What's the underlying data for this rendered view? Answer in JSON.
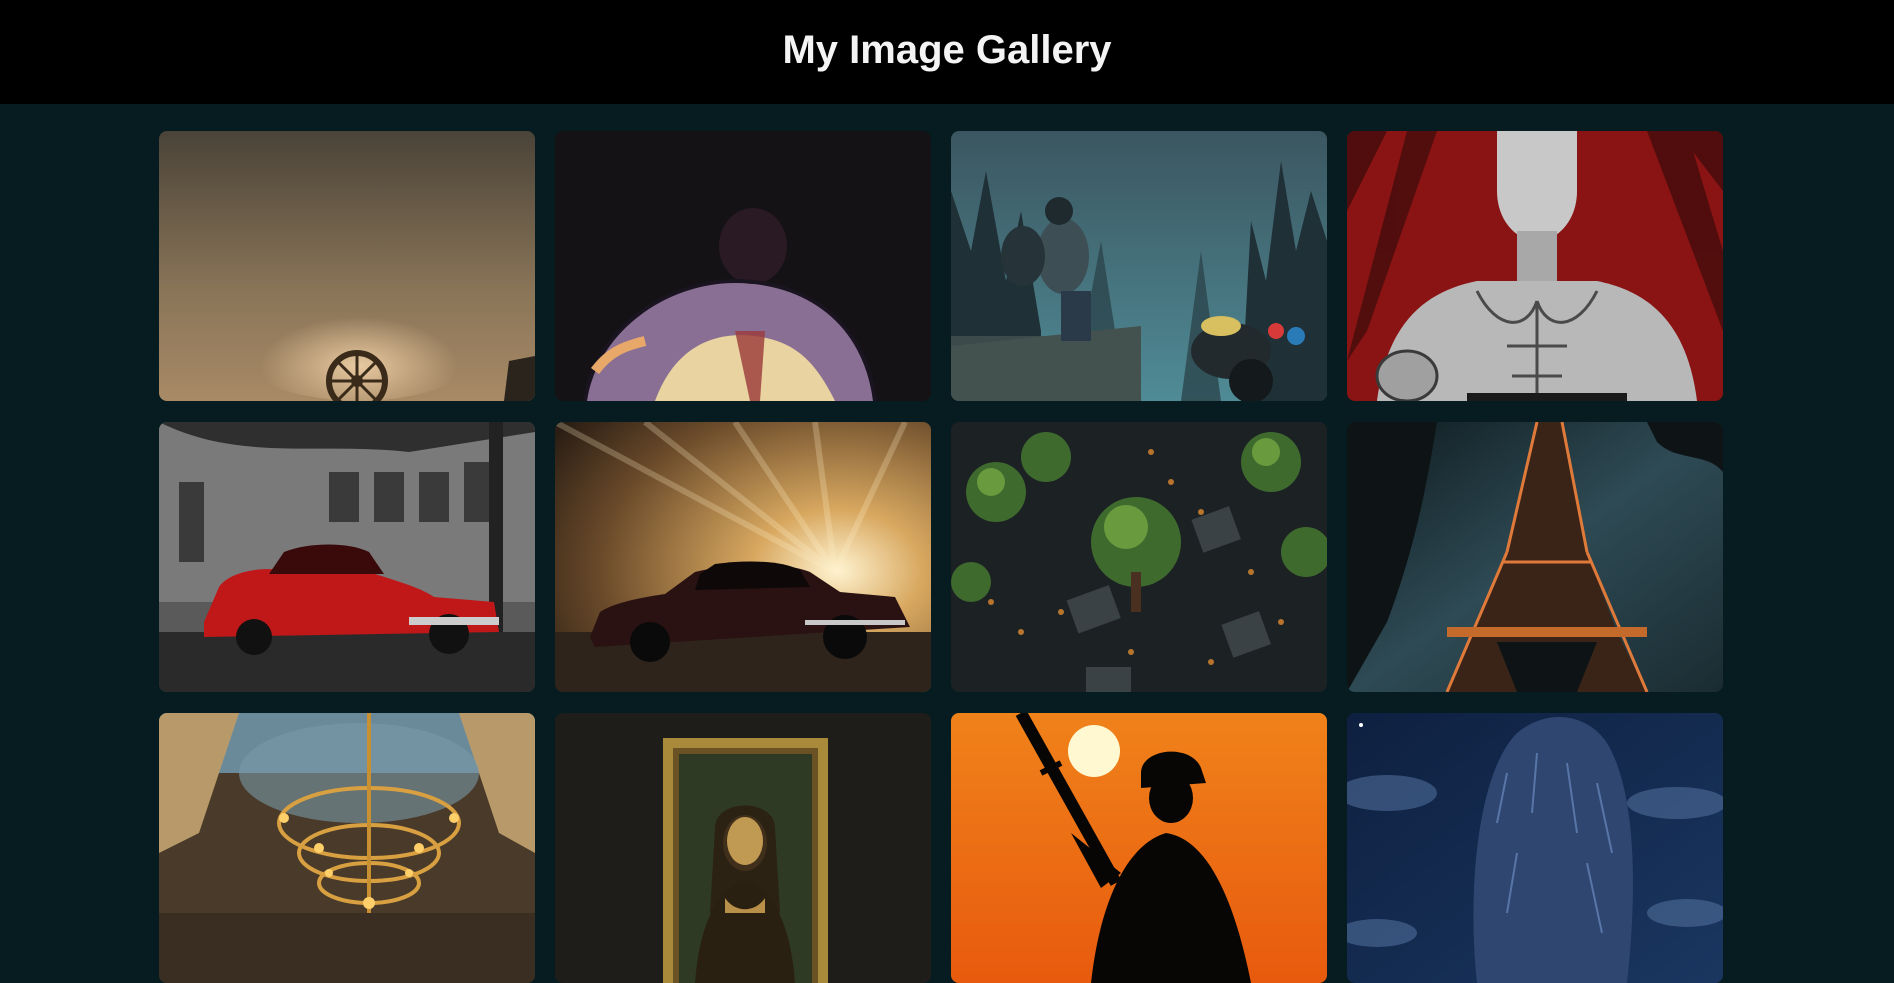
{
  "header": {
    "title": "My Image Gallery"
  },
  "gallery": {
    "images": [
      {
        "subject": "wagon-wheel-in-dust-cloud"
      },
      {
        "subject": "muscular-man-from-behind-comic"
      },
      {
        "subject": "hiker-with-motorcycle-in-misty-forest"
      },
      {
        "subject": "muscular-fighter-comic-red-background"
      },
      {
        "subject": "red-muscle-car-in-street"
      },
      {
        "subject": "dark-muscle-car-sunset-rays"
      },
      {
        "subject": "miniature-trees-on-circuit-board"
      },
      {
        "subject": "eiffel-tower-at-night"
      },
      {
        "subject": "ornate-chandelier-ceiling"
      },
      {
        "subject": "mona-lisa-framed-painting"
      },
      {
        "subject": "soldier-silhouette-orange-sunset"
      },
      {
        "subject": "furry-creature-night-sky"
      }
    ]
  }
}
